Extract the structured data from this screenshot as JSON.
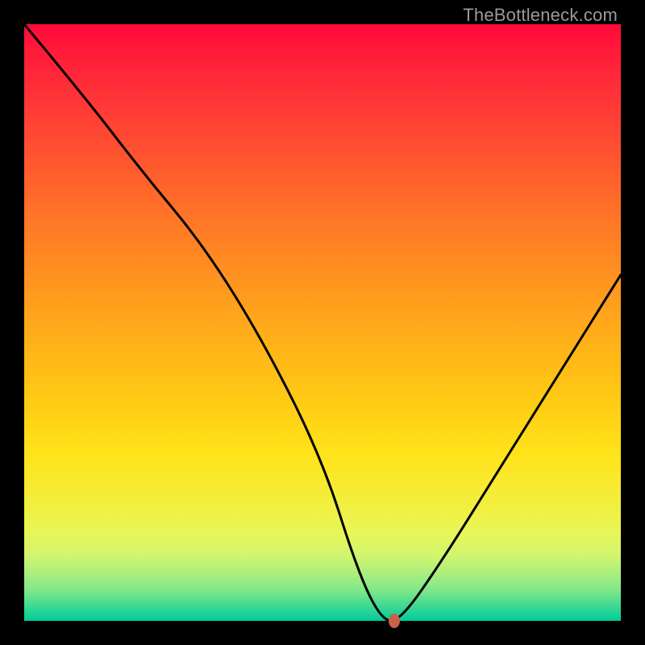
{
  "watermark": "TheBottleneck.com",
  "chart_data": {
    "type": "line",
    "title": "",
    "xlabel": "",
    "ylabel": "",
    "xlim": [
      0,
      100
    ],
    "ylim": [
      0,
      100
    ],
    "grid": false,
    "legend": false,
    "series": [
      {
        "name": "bottleneck-curve",
        "x": [
          0,
          10,
          20,
          30,
          40,
          50,
          56,
          60,
          63,
          70,
          80,
          90,
          100
        ],
        "y": [
          100,
          88,
          75,
          63,
          47,
          27,
          8,
          0,
          0,
          10,
          26,
          42,
          58
        ]
      }
    ],
    "marker": {
      "x": 62,
      "y": 0,
      "color": "#c8614b"
    },
    "background_gradient": {
      "type": "vertical",
      "stops": [
        {
          "pos": 0.0,
          "color": "#ff0a3a"
        },
        {
          "pos": 0.34,
          "color": "#ff7a26"
        },
        {
          "pos": 0.64,
          "color": "#ffcd14"
        },
        {
          "pos": 0.85,
          "color": "#e8f657"
        },
        {
          "pos": 1.0,
          "color": "#00cc99"
        }
      ]
    }
  }
}
